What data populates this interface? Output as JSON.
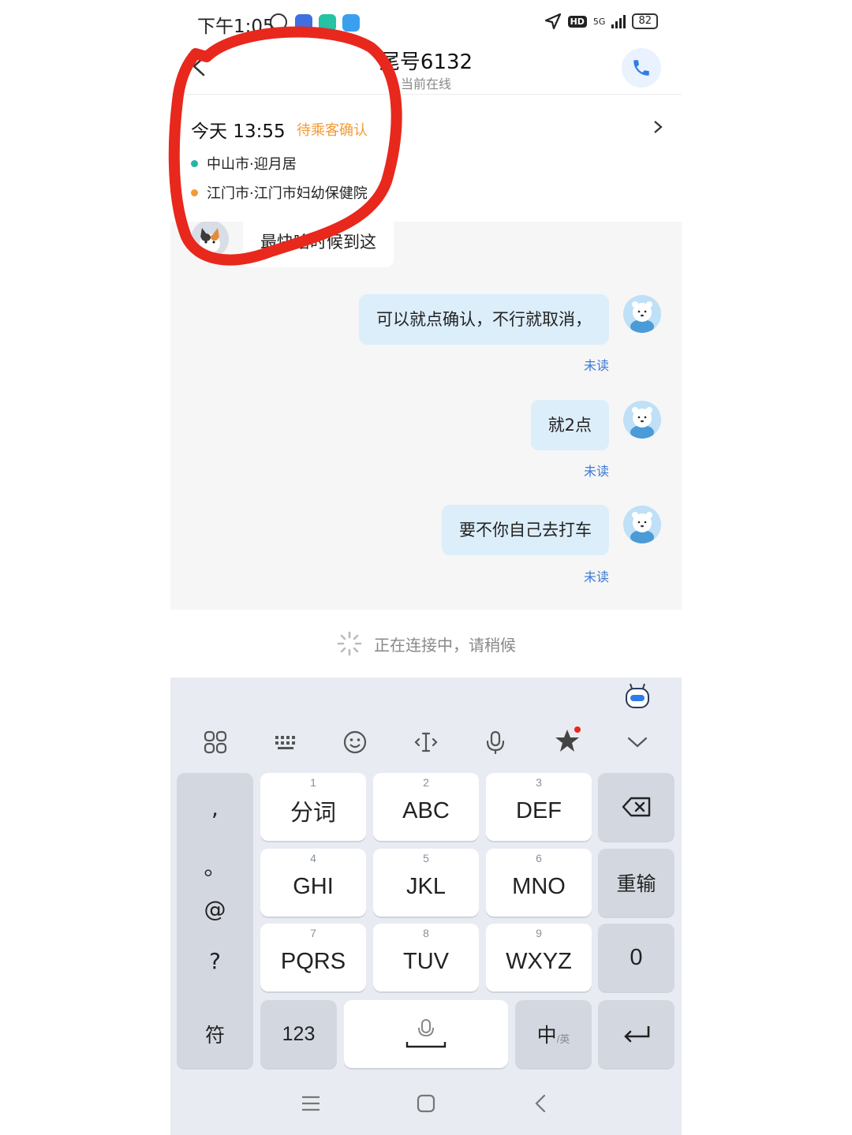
{
  "status_bar": {
    "time": "下午1:05",
    "network": "5G",
    "hd": "HD",
    "battery": "82"
  },
  "header": {
    "title": "尾号6132",
    "subtitle": "当前在线"
  },
  "order": {
    "time": "今天 13:55",
    "status": "待乘客确认",
    "pickup": "中山市·迎月居",
    "dropoff": "江门市·江门市妇幼保健院",
    "pickup_color": "#25b7a5",
    "dropoff_color": "#f39a36"
  },
  "messages": [
    {
      "side": "in",
      "text": "最快啥时候到这"
    },
    {
      "side": "out",
      "text": "可以就点确认，不行就取消，",
      "status": "未读"
    },
    {
      "side": "out",
      "text": "就2点",
      "status": "未读"
    },
    {
      "side": "out",
      "text": "要不你自己去打车",
      "status": "未读"
    }
  ],
  "connecting": {
    "text": "正在连接中，请稍候"
  },
  "keyboard": {
    "toolbar": [
      "apps-icon",
      "keyboard-icon",
      "emoji-icon",
      "cursor-icon",
      "mic-icon",
      "skin-icon",
      "collapse-icon"
    ],
    "punct": [
      ",",
      "。",
      "@",
      "?"
    ],
    "keys": [
      {
        "num": "1",
        "label": "分词"
      },
      {
        "num": "2",
        "label": "ABC"
      },
      {
        "num": "3",
        "label": "DEF"
      },
      {
        "num": "4",
        "label": "GHI"
      },
      {
        "num": "5",
        "label": "JKL"
      },
      {
        "num": "6",
        "label": "MNO"
      },
      {
        "num": "7",
        "label": "PQRS"
      },
      {
        "num": "8",
        "label": "TUV"
      },
      {
        "num": "9",
        "label": "WXYZ"
      }
    ],
    "reinput": "重输",
    "zero": "0",
    "symbols": "符",
    "numbers": "123",
    "lang": "中",
    "lang_sub": "/英"
  },
  "colors": {
    "accent": "#2f7bea",
    "annotation": "#e8281c"
  }
}
